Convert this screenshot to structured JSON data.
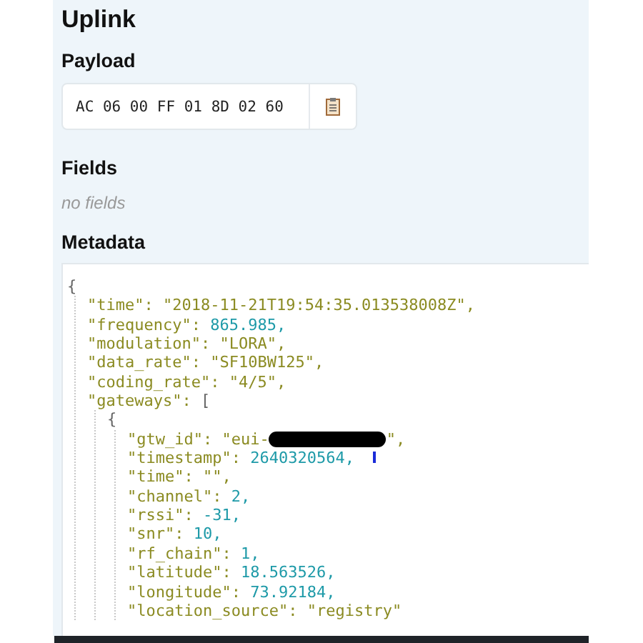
{
  "heading": "Uplink",
  "payload": {
    "label": "Payload",
    "value": "AC 06 00 FF 01 8D 02 60"
  },
  "fields": {
    "label": "Fields",
    "empty_text": "no fields"
  },
  "metadata": {
    "label": "Metadata",
    "document": {
      "open": "{",
      "children": [
        {
          "key": "\"time\":",
          "value": "\"2018-11-21T19:54:35.013538008Z\",",
          "kind": "string"
        },
        {
          "key": "\"frequency\":",
          "value": "865.985,",
          "kind": "number"
        },
        {
          "key": "\"modulation\":",
          "value": "\"LORA\",",
          "kind": "string"
        },
        {
          "key": "\"data_rate\":",
          "value": "\"SF10BW125\",",
          "kind": "string"
        },
        {
          "key": "\"coding_rate\":",
          "value": "\"4/5\",",
          "kind": "string"
        },
        {
          "key": "\"gateways\":",
          "value": "[",
          "kind": "punct",
          "children": [
            {
              "open": "{",
              "children": [
                {
                  "key": "\"gtw_id\":",
                  "value": "\"eui-",
                  "kind": "string",
                  "redacted": true,
                  "tail": "\","
                },
                {
                  "key": "\"timestamp\":",
                  "value": "2640320564,",
                  "kind": "number"
                },
                {
                  "key": "\"time\":",
                  "value": "\"\",",
                  "kind": "string"
                },
                {
                  "key": "\"channel\":",
                  "value": "2,",
                  "kind": "number"
                },
                {
                  "key": "\"rssi\":",
                  "value": "-31,",
                  "kind": "number"
                },
                {
                  "key": "\"snr\":",
                  "value": "10,",
                  "kind": "number"
                },
                {
                  "key": "\"rf_chain\":",
                  "value": "1,",
                  "kind": "number"
                },
                {
                  "key": "\"latitude\":",
                  "value": "18.563526,",
                  "kind": "number"
                },
                {
                  "key": "\"longitude\":",
                  "value": "73.92184,",
                  "kind": "number"
                },
                {
                  "key": "\"location_source\":",
                  "value": "\"registry\"",
                  "kind": "string"
                }
              ]
            }
          ]
        }
      ]
    }
  }
}
